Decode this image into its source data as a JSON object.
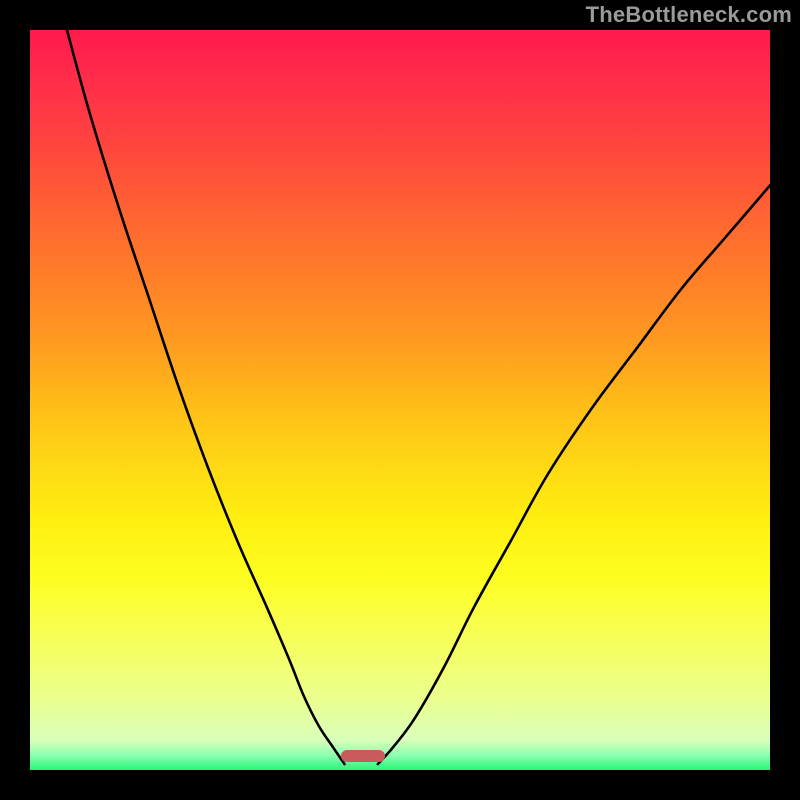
{
  "watermark": "TheBottleneck.com",
  "colors": {
    "background": "#000000",
    "curve": "#000000",
    "marker": "#c95b5d",
    "gradient_top": "#ff1a4d",
    "gradient_bottom": "#29f57a"
  },
  "chart_data": {
    "type": "line",
    "title": "",
    "xlabel": "",
    "ylabel": "",
    "xlim": [
      0,
      100
    ],
    "ylim": [
      0,
      100
    ],
    "grid": false,
    "legend": false,
    "series": [
      {
        "name": "left-curve",
        "x": [
          5,
          8,
          12,
          16,
          20,
          24,
          28,
          32,
          35,
          37,
          39,
          41,
          42.5
        ],
        "y": [
          100,
          89,
          76,
          64,
          52,
          41,
          31,
          22,
          15,
          10,
          6,
          3,
          0.8
        ]
      },
      {
        "name": "right-curve",
        "x": [
          47,
          49,
          52,
          56,
          60,
          65,
          70,
          76,
          82,
          88,
          94,
          100
        ],
        "y": [
          0.8,
          3,
          7,
          14,
          22,
          31,
          40,
          49,
          57,
          65,
          72,
          79
        ]
      }
    ],
    "marker": {
      "x_start": 42,
      "x_end": 48,
      "y": 0.8,
      "color": "#c95b5d"
    },
    "annotations": [
      {
        "text": "TheBottleneck.com",
        "position": "top-right"
      }
    ]
  }
}
